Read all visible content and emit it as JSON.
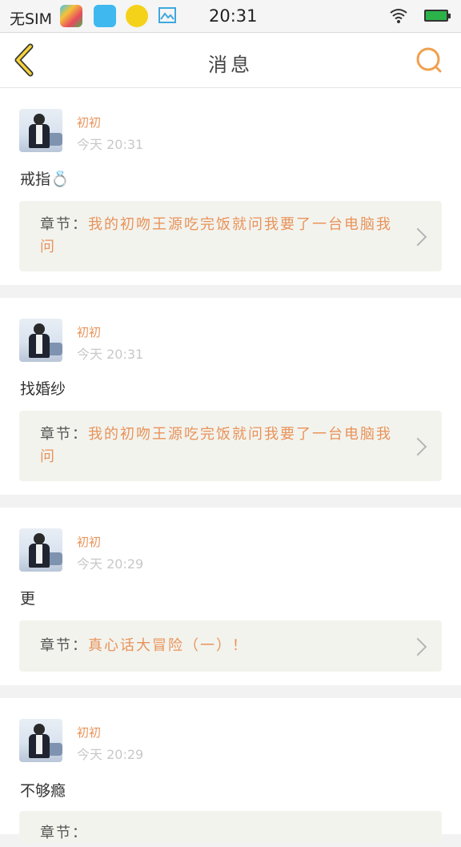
{
  "status_bar": {
    "carrier": "无SIM",
    "time": "20:31",
    "apps": [
      "store-app-icon",
      "shop-app-icon",
      "music-app-icon",
      "gallery-app-icon"
    ],
    "battery_color": "#2bb34a"
  },
  "header": {
    "title": "消息",
    "back_icon": "chevron-left-icon",
    "search_icon": "search-icon",
    "accent_color": "#f0a050"
  },
  "messages": [
    {
      "username": "初初",
      "time": "今天 20:31",
      "comment": "戒指💍",
      "chapter_label": "章节：",
      "chapter_title": "我的初吻王源吃完饭就问我要了一台电脑我问"
    },
    {
      "username": "初初",
      "time": "今天 20:31",
      "comment": "找婚纱",
      "chapter_label": "章节：",
      "chapter_title": "我的初吻王源吃完饭就问我要了一台电脑我问"
    },
    {
      "username": "初初",
      "time": "今天 20:29",
      "comment": "更",
      "chapter_label": "章节：",
      "chapter_title": "真心话大冒险（一）！"
    },
    {
      "username": "初初",
      "time": "今天 20:29",
      "comment": "不够瘾",
      "chapter_label": "章节：",
      "chapter_title": ""
    }
  ]
}
